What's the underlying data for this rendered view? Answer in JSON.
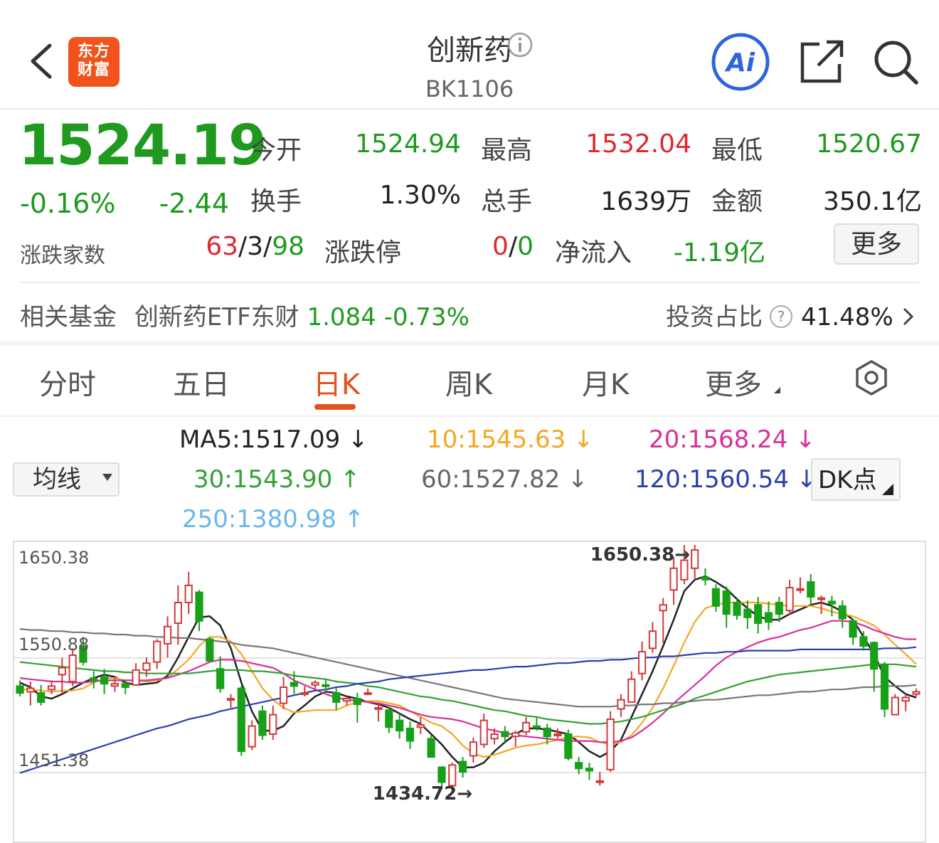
{
  "header": {
    "logo_line1": "东方",
    "logo_line2": "财富",
    "title": "创新药",
    "code": "BK1106",
    "ai_label": "Ai"
  },
  "quote": {
    "price": "1524.19",
    "change_pct": "-0.16%",
    "change": "-2.44",
    "open_label": "今开",
    "open": "1524.94",
    "high_label": "最高",
    "high": "1532.04",
    "low_label": "最低",
    "low": "1520.67",
    "turnover_label": "换手",
    "turnover": "1.30%",
    "volume_label": "总手",
    "volume": "1639万",
    "amount_label": "金额",
    "amount": "350.1亿",
    "breadth_label": "涨跌家数",
    "breadth_up": "63",
    "breadth_flat": "3",
    "breadth_down": "98",
    "limit_label": "涨跌停",
    "limit_up": "0",
    "limit_down": "0",
    "netflow_label": "净流入",
    "netflow": "-1.19亿",
    "more_label": "更多"
  },
  "fund": {
    "label": "相关基金",
    "name": "创新药ETF东财",
    "price": "1.084",
    "change": "-0.73%",
    "invest_label": "投资占比",
    "invest_value": "41.48%"
  },
  "tabs": {
    "items": [
      "分时",
      "五日",
      "日K",
      "周K",
      "月K",
      "更多"
    ],
    "active": "日K"
  },
  "ma": {
    "selector": "均线",
    "dk_label": "DK点",
    "ma5": "MA5:1517.09",
    "ma5_arrow": "↓",
    "ma10": "10:1545.63",
    "ma10_arrow": "↓",
    "ma20": "20:1568.24",
    "ma20_arrow": "↓",
    "ma30": "30:1543.90",
    "ma30_arrow": "↑",
    "ma60": "60:1527.82",
    "ma60_arrow": "↓",
    "ma120": "120:1560.54",
    "ma120_arrow": "↓",
    "ma250": "250:1380.98",
    "ma250_arrow": "↑",
    "colors": {
      "ma5": "#222222",
      "ma10": "#f5a623",
      "ma20": "#d6309a",
      "ma30": "#35a035",
      "ma60": "#777777",
      "ma120": "#2a3fb0",
      "ma250": "#6ab7ea"
    }
  },
  "chart_data": {
    "type": "candlestick",
    "y_top_label": "1650.38",
    "y_mid_label": "1550.88",
    "y_bottom_label": "1451.38",
    "max_label": "1650.38→",
    "min_label": "1434.72→",
    "ylim": [
      1451.38,
      1650.38
    ],
    "candles": [
      [
        1527,
        1521,
        1532,
        1518
      ],
      [
        1522,
        1525,
        1531,
        1510
      ],
      [
        1521,
        1513,
        1528,
        1510
      ],
      [
        1524,
        1527,
        1532,
        1520
      ],
      [
        1537,
        1543,
        1552,
        1520
      ],
      [
        1531,
        1554,
        1560,
        1527
      ],
      [
        1562,
        1548,
        1570,
        1545
      ],
      [
        1534,
        1532,
        1540,
        1525
      ],
      [
        1535,
        1529,
        1542,
        1520
      ],
      [
        1527,
        1529,
        1534,
        1522
      ],
      [
        1529,
        1526,
        1532,
        1520
      ],
      [
        1528,
        1541,
        1547,
        1528
      ],
      [
        1541,
        1547,
        1552,
        1535
      ],
      [
        1548,
        1566,
        1568,
        1542
      ],
      [
        1564,
        1579,
        1588,
        1552
      ],
      [
        1582,
        1600,
        1615,
        1563
      ],
      [
        1600,
        1615,
        1627,
        1590
      ],
      [
        1609,
        1584,
        1611,
        1575
      ],
      [
        1568,
        1549,
        1570,
        1548
      ],
      [
        1542,
        1525,
        1553,
        1521
      ],
      [
        1516,
        1516,
        1520,
        1508
      ],
      [
        1525,
        1470,
        1527,
        1466
      ],
      [
        1474,
        1492,
        1497,
        1471
      ],
      [
        1505,
        1484,
        1510,
        1480
      ],
      [
        1485,
        1502,
        1510,
        1480
      ],
      [
        1512,
        1526,
        1535,
        1507
      ],
      [
        1530,
        1527,
        1540,
        1520
      ],
      [
        1521,
        1521,
        1527,
        1518
      ],
      [
        1528,
        1530,
        1532,
        1524
      ],
      [
        1528,
        1527,
        1533,
        1521
      ],
      [
        1521,
        1513,
        1525,
        1506
      ],
      [
        1514,
        1516,
        1518,
        1510
      ],
      [
        1516,
        1511,
        1521,
        1495
      ],
      [
        1521,
        1521,
        1525,
        1519
      ],
      [
        1508,
        1508,
        1512,
        1496
      ],
      [
        1506,
        1491,
        1509,
        1486
      ],
      [
        1497,
        1488,
        1503,
        1481
      ],
      [
        1490,
        1479,
        1496,
        1472
      ],
      [
        1491,
        1493,
        1500,
        1485
      ],
      [
        1481,
        1465,
        1484,
        1465
      ],
      [
        1456,
        1443,
        1457,
        1437
      ],
      [
        1440,
        1458,
        1460,
        1434.72
      ],
      [
        1461,
        1452,
        1465,
        1447
      ],
      [
        1466,
        1478,
        1482,
        1460
      ],
      [
        1476,
        1497,
        1503,
        1473
      ],
      [
        1481,
        1485,
        1490,
        1476
      ],
      [
        1487,
        1483,
        1492,
        1478
      ],
      [
        1483,
        1486,
        1488,
        1474
      ],
      [
        1487,
        1495,
        1500,
        1484
      ],
      [
        1492,
        1491,
        1500,
        1488
      ],
      [
        1490,
        1483,
        1494,
        1476
      ],
      [
        1484,
        1485,
        1490,
        1481
      ],
      [
        1485,
        1464,
        1489,
        1462
      ],
      [
        1460,
        1455,
        1465,
        1450
      ],
      [
        1455,
        1453,
        1460,
        1445
      ],
      [
        1443,
        1444,
        1452,
        1440
      ],
      [
        1454,
        1498,
        1505,
        1452
      ],
      [
        1507,
        1515,
        1520,
        1500
      ],
      [
        1513,
        1533,
        1540,
        1513
      ],
      [
        1538,
        1557,
        1566,
        1532
      ],
      [
        1560,
        1575,
        1583,
        1556
      ],
      [
        1593,
        1598,
        1604,
        1565
      ],
      [
        1611,
        1630,
        1640,
        1598
      ],
      [
        1620,
        1637,
        1650.38,
        1616
      ],
      [
        1630,
        1646,
        1650.38,
        1620
      ],
      [
        1622,
        1620,
        1630,
        1615
      ],
      [
        1612,
        1597,
        1616,
        1592
      ],
      [
        1610,
        1590,
        1614,
        1578
      ],
      [
        1600,
        1589,
        1603,
        1585
      ],
      [
        1594,
        1587,
        1602,
        1577
      ],
      [
        1598,
        1582,
        1605,
        1573
      ],
      [
        1591,
        1583,
        1601,
        1576
      ],
      [
        1600,
        1590,
        1605,
        1583
      ],
      [
        1593,
        1613,
        1620,
        1589
      ],
      [
        1612,
        1612,
        1622,
        1608
      ],
      [
        1618,
        1605,
        1625,
        1598
      ],
      [
        1603,
        1604,
        1606,
        1590
      ],
      [
        1601,
        1599,
        1606,
        1588
      ],
      [
        1597,
        1586,
        1602,
        1578
      ],
      [
        1584,
        1570,
        1586,
        1563
      ],
      [
        1570,
        1562,
        1575,
        1558
      ],
      [
        1565,
        1542,
        1566,
        1522
      ],
      [
        1546,
        1507,
        1548,
        1500
      ],
      [
        1502,
        1517,
        1520,
        1508
      ],
      [
        1514,
        1517,
        1520,
        1505
      ],
      [
        1520,
        1522,
        1525,
        1518
      ]
    ],
    "ma_series": {
      "ma5": [
        1530,
        1526,
        1518,
        1516,
        1520,
        1525,
        1530,
        1534,
        1537,
        1535,
        1530,
        1528,
        1529,
        1530,
        1536,
        1552,
        1570,
        1587,
        1588,
        1580,
        1560,
        1530,
        1505,
        1488,
        1488,
        1492,
        1503,
        1510,
        1518,
        1522,
        1521,
        1518,
        1516,
        1513,
        1511,
        1508,
        1503,
        1498,
        1494,
        1485,
        1476,
        1465,
        1456,
        1456,
        1460,
        1470,
        1478,
        1485,
        1490,
        1490,
        1489,
        1487,
        1485,
        1478,
        1470,
        1465,
        1470,
        1480,
        1500,
        1520,
        1540,
        1562,
        1585,
        1610,
        1620,
        1623,
        1618,
        1612,
        1603,
        1595,
        1588,
        1585,
        1585,
        1590,
        1594,
        1598,
        1600,
        1597,
        1592,
        1585,
        1570,
        1555,
        1535,
        1527,
        1520,
        1517
      ],
      "ma10": [
        1524,
        1524,
        1523,
        1522,
        1523,
        1523,
        1525,
        1530,
        1534,
        1534,
        1532,
        1532,
        1531,
        1532,
        1534,
        1542,
        1550,
        1562,
        1570,
        1570,
        1566,
        1555,
        1540,
        1525,
        1515,
        1508,
        1504,
        1505,
        1506,
        1506,
        1506,
        1510,
        1513,
        1514,
        1514,
        1512,
        1510,
        1505,
        1500,
        1495,
        1492,
        1485,
        1475,
        1468,
        1465,
        1467,
        1470,
        1473,
        1475,
        1476,
        1478,
        1480,
        1482,
        1483,
        1482,
        1478,
        1476,
        1478,
        1484,
        1495,
        1508,
        1525,
        1545,
        1565,
        1583,
        1595,
        1598,
        1600,
        1600,
        1600,
        1600,
        1599,
        1598,
        1597,
        1597,
        1597,
        1595,
        1592,
        1590,
        1588,
        1584,
        1580,
        1572,
        1563,
        1555,
        1546
      ],
      "ma20": [
        1534,
        1533,
        1532,
        1531,
        1531,
        1530,
        1530,
        1531,
        1532,
        1532,
        1532,
        1532,
        1532,
        1533,
        1534,
        1537,
        1540,
        1544,
        1548,
        1550,
        1550,
        1549,
        1547,
        1545,
        1543,
        1538,
        1532,
        1528,
        1524,
        1520,
        1517,
        1515,
        1514,
        1513,
        1512,
        1510,
        1508,
        1505,
        1502,
        1500,
        1499,
        1498,
        1496,
        1493,
        1490,
        1488,
        1486,
        1484,
        1483,
        1482,
        1481,
        1480,
        1479,
        1479,
        1479,
        1478,
        1478,
        1479,
        1482,
        1488,
        1495,
        1503,
        1512,
        1520,
        1528,
        1536,
        1545,
        1552,
        1557,
        1561,
        1565,
        1568,
        1570,
        1573,
        1576,
        1578,
        1581,
        1584,
        1584,
        1583,
        1580,
        1576,
        1573,
        1570,
        1568,
        1568
      ],
      "ma30": [
        1548,
        1547,
        1546,
        1545,
        1544,
        1543,
        1542,
        1541,
        1540,
        1540,
        1539,
        1539,
        1538,
        1538,
        1538,
        1538,
        1538,
        1539,
        1540,
        1541,
        1541,
        1541,
        1540,
        1540,
        1539,
        1538,
        1536,
        1535,
        1534,
        1533,
        1531,
        1530,
        1529,
        1527,
        1526,
        1524,
        1522,
        1520,
        1518,
        1517,
        1515,
        1514,
        1512,
        1510,
        1508,
        1506,
        1505,
        1503,
        1501,
        1500,
        1498,
        1497,
        1496,
        1495,
        1494,
        1494,
        1495,
        1496,
        1498,
        1500,
        1503,
        1506,
        1509,
        1512,
        1516,
        1519,
        1522,
        1525,
        1528,
        1531,
        1533,
        1535,
        1537,
        1538,
        1539,
        1540,
        1541,
        1542,
        1543,
        1544,
        1545,
        1546,
        1546,
        1546,
        1545,
        1544
      ],
      "ma60": [
        1577,
        1576,
        1576,
        1575,
        1575,
        1574,
        1574,
        1573,
        1573,
        1572,
        1572,
        1571,
        1571,
        1570,
        1570,
        1569,
        1569,
        1568,
        1567,
        1566,
        1565,
        1563,
        1562,
        1561,
        1560,
        1558,
        1556,
        1554,
        1552,
        1550,
        1548,
        1546,
        1544,
        1542,
        1540,
        1538,
        1536,
        1534,
        1532,
        1530,
        1528,
        1526,
        1524,
        1522,
        1520,
        1518,
        1516,
        1515,
        1514,
        1513,
        1512,
        1511,
        1510,
        1509,
        1509,
        1509,
        1509,
        1510,
        1510,
        1511,
        1511,
        1512,
        1512,
        1513,
        1514,
        1515,
        1515,
        1516,
        1517,
        1518,
        1519,
        1519,
        1520,
        1521,
        1522,
        1522,
        1523,
        1524,
        1524,
        1525,
        1526,
        1526,
        1527,
        1527,
        1527,
        1528
      ],
      "ma120": [
        1451,
        1454,
        1457,
        1460,
        1463,
        1466,
        1469,
        1472,
        1475,
        1478,
        1481,
        1484,
        1487,
        1490,
        1492,
        1495,
        1498,
        1500,
        1502,
        1505,
        1507,
        1509,
        1511,
        1513,
        1515,
        1517,
        1519,
        1521,
        1523,
        1524,
        1526,
        1527,
        1529,
        1530,
        1531,
        1533,
        1534,
        1535,
        1536,
        1537,
        1538,
        1539,
        1540,
        1541,
        1541,
        1542,
        1543,
        1544,
        1544,
        1545,
        1546,
        1547,
        1547,
        1548,
        1549,
        1549,
        1550,
        1550,
        1551,
        1552,
        1552,
        1553,
        1553,
        1554,
        1555,
        1556,
        1556,
        1557,
        1557,
        1558,
        1558,
        1558,
        1558,
        1558,
        1559,
        1559,
        1559,
        1559,
        1559,
        1559,
        1559,
        1559,
        1560,
        1560,
        1560,
        1561
      ]
    }
  }
}
